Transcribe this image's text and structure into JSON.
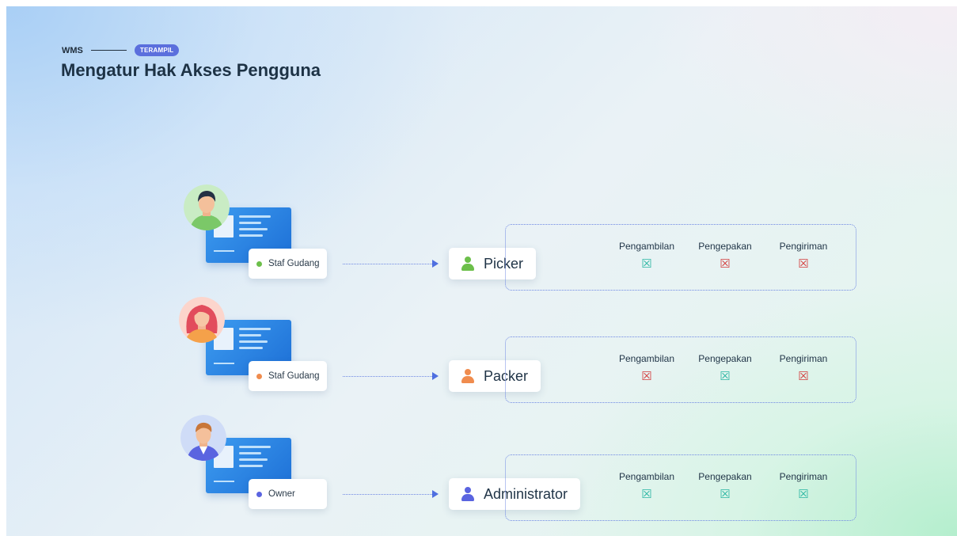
{
  "header": {
    "app": "WMS",
    "badge": "TERAMPIL",
    "title": "Mengatur Hak Akses Pengguna"
  },
  "colors": {
    "green_dot": "#6cbf4a",
    "orange_dot": "#f08c4e",
    "blue_dot": "#5a64e0",
    "allowed": "#2bb6a3",
    "denied": "#d43b3b",
    "connector": "#4f6fe0"
  },
  "rows": [
    {
      "badge_label": "Staf Gudang",
      "badge_dot": "green",
      "role": "Picker",
      "role_icon": "user-icon-green",
      "permissions": [
        {
          "label": "Pengambilan",
          "state": "allowed",
          "mark": "☒"
        },
        {
          "label": "Pengepakan",
          "state": "denied",
          "mark": "☒"
        },
        {
          "label": "Pengiriman",
          "state": "denied",
          "mark": "☒"
        }
      ]
    },
    {
      "badge_label": "Staf Gudang",
      "badge_dot": "orange",
      "role": "Packer",
      "role_icon": "user-icon-orange",
      "permissions": [
        {
          "label": "Pengambilan",
          "state": "denied",
          "mark": "☒"
        },
        {
          "label": "Pengepakan",
          "state": "allowed",
          "mark": "☒"
        },
        {
          "label": "Pengiriman",
          "state": "denied",
          "mark": "☒"
        }
      ]
    },
    {
      "badge_label": "Owner",
      "badge_dot": "blue",
      "role": "Administrator",
      "role_icon": "user-icon-blue",
      "permissions": [
        {
          "label": "Pengambilan",
          "state": "allowed",
          "mark": "☒"
        },
        {
          "label": "Pengepakan",
          "state": "allowed",
          "mark": "☒"
        },
        {
          "label": "Pengiriman",
          "state": "allowed",
          "mark": "☒"
        }
      ]
    }
  ]
}
